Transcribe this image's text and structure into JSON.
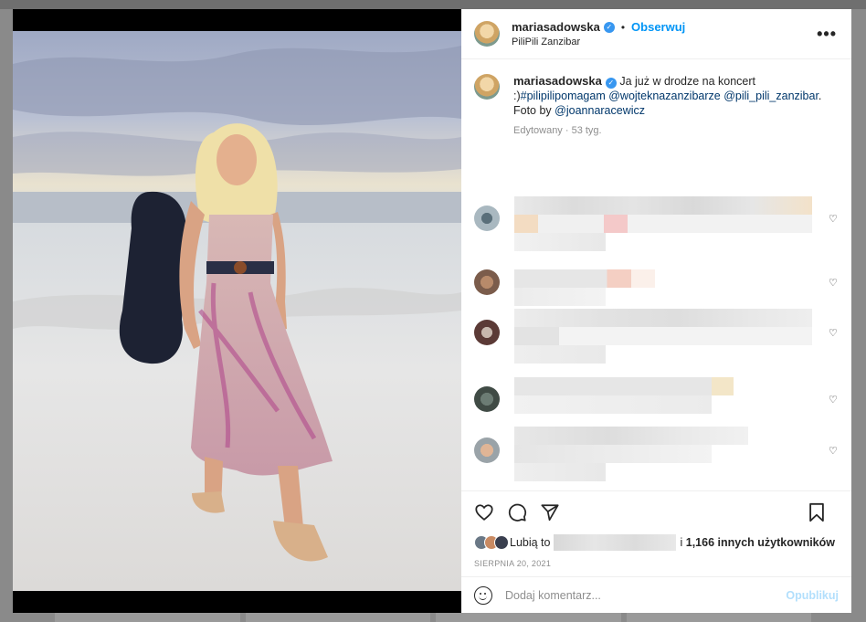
{
  "post": {
    "username": "mariasadowska",
    "follow_label": "Obserwuj",
    "separator": "•",
    "location": "PiliPili Zanzibar",
    "more_label": "•••"
  },
  "caption": {
    "username": "mariasadowska",
    "text_1": "Ja już w drodze na koncert :)",
    "tag_1": "#pilipilipomagam",
    "tag_2": "@wojteknazanzibarze",
    "tag_3": "@pili_pili_zanzibar",
    "text_2": ". Foto by ",
    "tag_4": "@joannaracewicz",
    "meta": "Edytowany · 53 tyg."
  },
  "likes": {
    "prefix": "Lubią to",
    "conjunction": "i",
    "others": "1,166 innych użytkowników"
  },
  "date": "SIERPNIA 20, 2021",
  "comment_box": {
    "placeholder": "Dodaj komentarz...",
    "post_label": "Opublikuj"
  },
  "icons": {
    "heart": "heart-icon",
    "comment": "comment-icon",
    "share": "share-icon",
    "save": "bookmark-icon",
    "emoji": "emoji-icon",
    "more": "more-options-icon",
    "verified": "verified-badge-icon"
  },
  "colors": {
    "accent": "#0095f6",
    "verified": "#3897f0",
    "post_disabled": "#b2dffc"
  }
}
